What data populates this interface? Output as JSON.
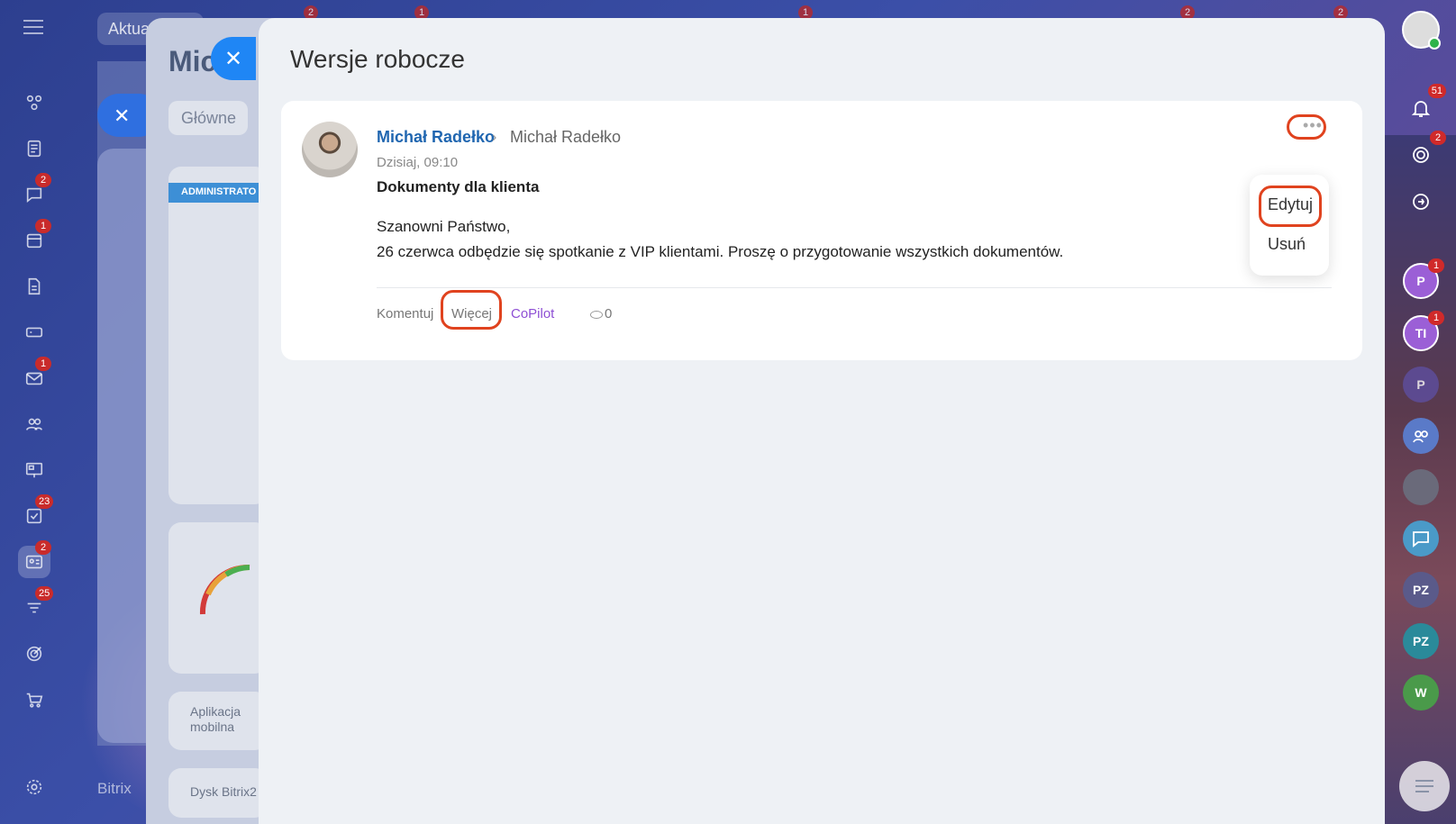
{
  "background": {
    "top_button": "Aktua",
    "panel_title": "Mic",
    "tab": "Główne",
    "admin_label": "ADMINISTRATO",
    "card_mobile": "Aplikacja mobilna",
    "card_disk": "Dysk Bitrix2",
    "bottom_text": "Bitrix",
    "top_badges": [
      "2",
      "1",
      "1",
      "2",
      "2"
    ]
  },
  "left_nav": [
    {
      "icon": "activity-icon",
      "badge": ""
    },
    {
      "icon": "feed-icon",
      "badge": ""
    },
    {
      "icon": "chat-icon",
      "badge": "2"
    },
    {
      "icon": "calendar-icon",
      "badge": "1"
    },
    {
      "icon": "document-icon",
      "badge": ""
    },
    {
      "icon": "drive-icon",
      "badge": ""
    },
    {
      "icon": "mail-icon",
      "badge": "1"
    },
    {
      "icon": "users-icon",
      "badge": ""
    },
    {
      "icon": "board-icon",
      "badge": ""
    },
    {
      "icon": "tasks-icon",
      "badge": "23"
    },
    {
      "icon": "contacts-icon",
      "badge": "2"
    },
    {
      "icon": "filter-icon",
      "badge": "25"
    },
    {
      "icon": "target-icon",
      "badge": ""
    },
    {
      "icon": "cart-icon",
      "badge": ""
    },
    {
      "icon": "settings-icon",
      "badge": ""
    }
  ],
  "slider": {
    "title": "Wersje robocze",
    "post": {
      "author": "Michał Radełko",
      "recipient": "Michał Radełko",
      "date": "Dzisiaj, 09:10",
      "title": "Dokumenty dla klienta",
      "body_line1": "Szanowni Państwo,",
      "body_line2": "26 czerwca odbędzie się spotkanie z VIP klientami. Proszę o przygotowanie wszystkich dokumentów.",
      "actions": {
        "comment": "Komentuj",
        "more": "Więcej",
        "copilot": "CoPilot",
        "views": "0"
      },
      "menu": {
        "more_dots": "•••",
        "edit": "Edytuj",
        "delete": "Usuń"
      }
    }
  },
  "right_bar": {
    "notifications_badge": "51",
    "feed_badge": "2",
    "chats": [
      {
        "initials": "P",
        "badge": "1",
        "color": "#9b5fd6"
      },
      {
        "initials": "TI",
        "badge": "1",
        "color": "#9b5fd6"
      },
      {
        "initials": "P",
        "badge": "",
        "color": "#6a5aa8"
      },
      {
        "initials": "",
        "badge": "",
        "color": "#5a7ac8"
      },
      {
        "initials": "",
        "badge": "",
        "color": "#6a6a7a"
      },
      {
        "initials": "",
        "badge": "",
        "color": "#4a9ac8"
      },
      {
        "initials": "PZ",
        "badge": "",
        "color": "#5a5a8a"
      },
      {
        "initials": "PZ",
        "badge": "",
        "color": "#2a8a9a"
      },
      {
        "initials": "W",
        "badge": "",
        "color": "#4a9a4a"
      }
    ]
  },
  "colors": {
    "highlight_ring": "#e0431f",
    "author_link": "#2066b0",
    "copilot": "#8e4fd4",
    "close_button": "#1f86f5"
  }
}
